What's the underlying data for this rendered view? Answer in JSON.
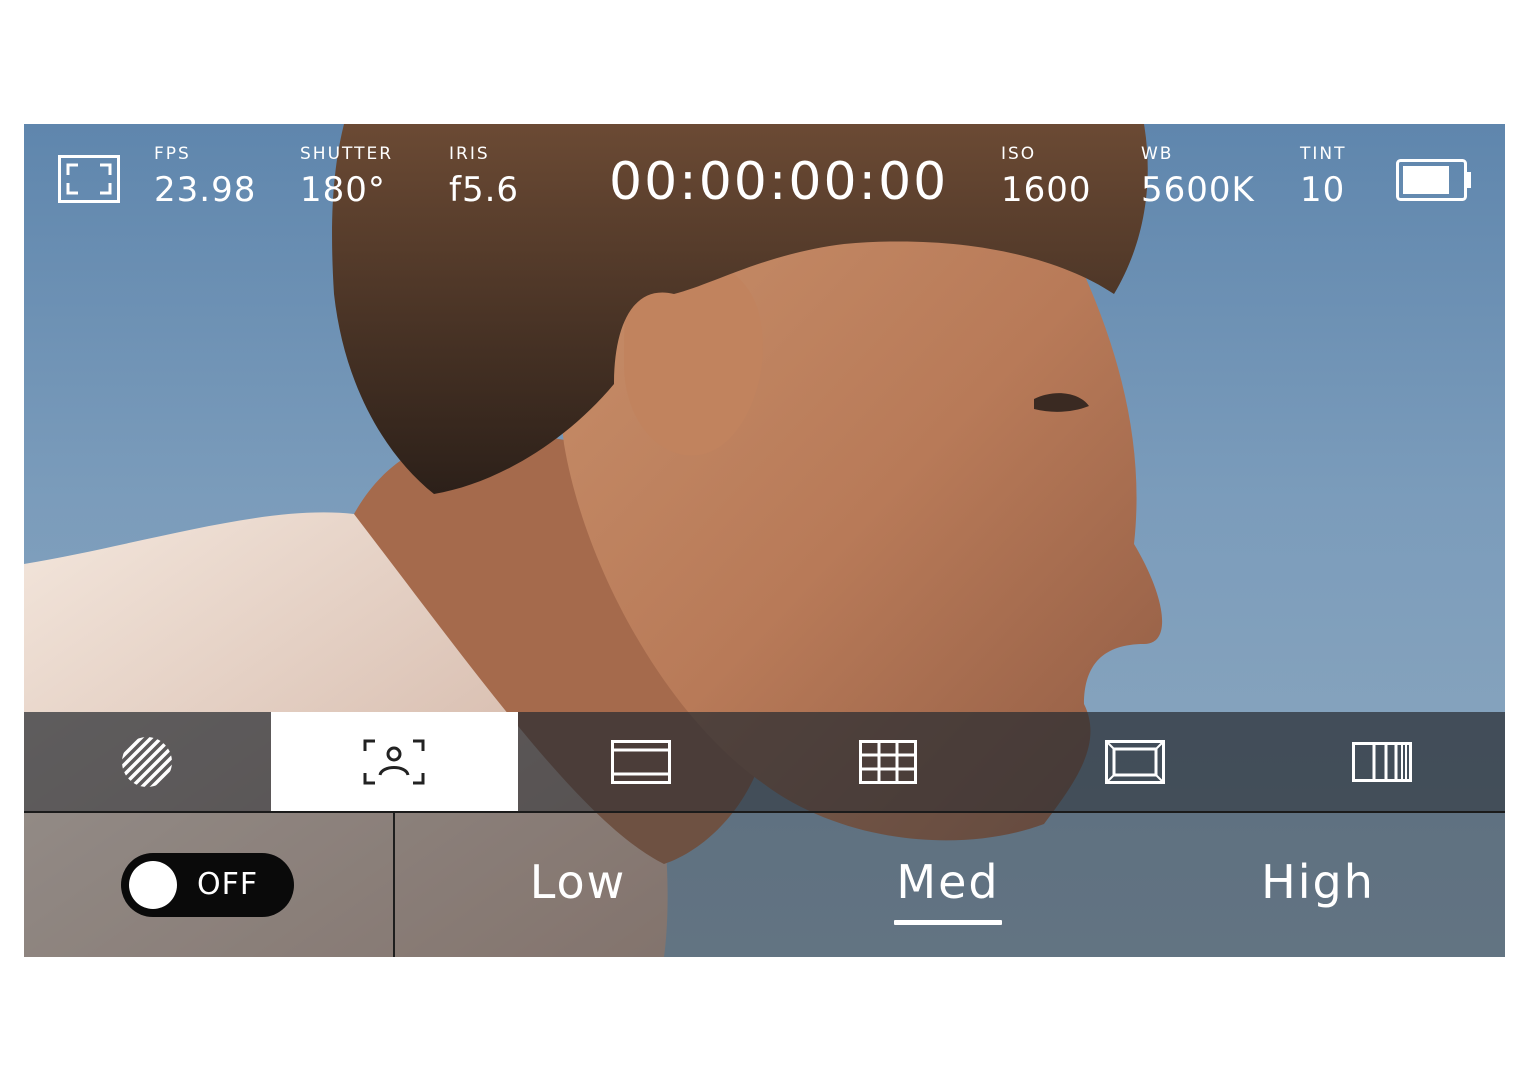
{
  "top_status": {
    "fps": {
      "label": "FPS",
      "value": "23.98"
    },
    "shutter": {
      "label": "SHUTTER",
      "value": "180°"
    },
    "iris": {
      "label": "IRIS",
      "value": "f5.6"
    },
    "timecode": "00:00:00:00",
    "iso": {
      "label": "ISO",
      "value": "1600"
    },
    "wb": {
      "label": "WB",
      "value": "5600K"
    },
    "tint": {
      "label": "TINT",
      "value": "10"
    },
    "battery_level": 0.8
  },
  "icons": {
    "frame": "frame-guide-icon",
    "battery": "battery-icon"
  },
  "toolbar": {
    "items": [
      {
        "name": "zebra-icon",
        "active": false
      },
      {
        "name": "focus-assist-icon",
        "active": true
      },
      {
        "name": "frame-guides-icon",
        "active": false
      },
      {
        "name": "grid-icon",
        "active": false
      },
      {
        "name": "safe-area-icon",
        "active": false
      },
      {
        "name": "false-color-icon",
        "active": false
      }
    ]
  },
  "options": {
    "toggle_label": "OFF",
    "levels": [
      "Low",
      "Med",
      "High"
    ],
    "selected": "Med"
  },
  "colors": {
    "sky": "#6a8fb4",
    "active_tab": "#ffffff",
    "toolbar_bg": "#2c3036"
  }
}
